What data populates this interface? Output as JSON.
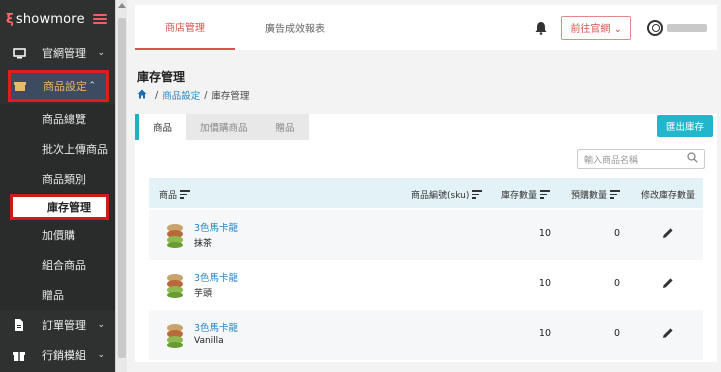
{
  "brand": {
    "name": "showmore"
  },
  "sidebar": {
    "items": [
      {
        "label": "官網管理",
        "icon": "monitor-icon"
      },
      {
        "label": "商品設定",
        "icon": "box-icon"
      },
      {
        "label": "訂單管理",
        "icon": "document-icon"
      },
      {
        "label": "行銷模組",
        "icon": "gift-icon"
      }
    ],
    "sub_items": [
      {
        "label": "商品總覽"
      },
      {
        "label": "批次上傳商品"
      },
      {
        "label": "商品類別"
      },
      {
        "label": "庫存管理"
      },
      {
        "label": "加價購"
      },
      {
        "label": "組合商品"
      },
      {
        "label": "贈品"
      }
    ]
  },
  "header": {
    "tabs": [
      {
        "label": "商店管理"
      },
      {
        "label": "廣告成效報表"
      }
    ],
    "visit_label": "前往官網 ⌄"
  },
  "page": {
    "title": "庫存管理",
    "breadcrumb": {
      "parent": "商品設定",
      "current": "庫存管理"
    }
  },
  "subtabs": [
    {
      "label": "商品"
    },
    {
      "label": "加價購商品"
    },
    {
      "label": "贈品"
    }
  ],
  "export_label": "匯出庫存",
  "search": {
    "placeholder": "輸入商品名稱"
  },
  "table": {
    "headers": {
      "product": "商品",
      "sku": "商品編號(sku)",
      "stock": "庫存數量",
      "preset": "預購數量",
      "edit": "修改庫存數量"
    },
    "rows": [
      {
        "name": "3色馬卡龍",
        "flavor": "抹茶",
        "stock": "10",
        "preset": "0"
      },
      {
        "name": "3色馬卡龍",
        "flavor": "芋頭",
        "stock": "10",
        "preset": "0"
      },
      {
        "name": "3色馬卡龍",
        "flavor": "Vanilla",
        "stock": "10",
        "preset": "0"
      }
    ]
  },
  "colors": {
    "accent": "#d9534f",
    "primary": "#22b5cc",
    "sidebar_bg": "#2f3030",
    "highlight": "#e01c1c"
  }
}
